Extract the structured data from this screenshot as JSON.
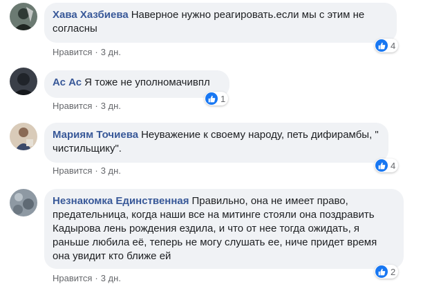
{
  "comments": [
    {
      "author": "Хава Хазбиева",
      "text": "Наверное нужно реагировать.если мы с этим не согласны",
      "like_label": "Нравится",
      "separator": "·",
      "time": "3 дн.",
      "reaction_count": "4",
      "avatar_color": "#4a5a52"
    },
    {
      "author": "Ас Ас",
      "text": "Я тоже не уполномачивпл",
      "like_label": "Нравится",
      "separator": "·",
      "time": "3 дн.",
      "reaction_count": "1",
      "avatar_color": "#2b2f36"
    },
    {
      "author": "Мариям Точиева",
      "text": "Неуважение к своему народу, петь дифирамбы, \" чистильщику\".",
      "like_label": "Нравится",
      "separator": "·",
      "time": "3 дн.",
      "reaction_count": "4",
      "avatar_color": "#c9b8a6"
    },
    {
      "author": "Незнакомка Единственная",
      "text": "Правильно, она не имеет право, предательница, когда наши все на митинге стояли она поздравить Кадырова лень рождения ездила, и что от нее тогда ожидать, я раньше любила её, теперь не могу слушать ее, ниче придет время она увидит кто ближе ей",
      "like_label": "Нравится",
      "separator": "·",
      "time": "3 дн.",
      "reaction_count": "2",
      "avatar_color": "#7a8590"
    }
  ],
  "colors": {
    "author": "#385898",
    "bubble": "#f0f2f5",
    "like_icon": "#1877f2",
    "meta": "#65676b"
  }
}
